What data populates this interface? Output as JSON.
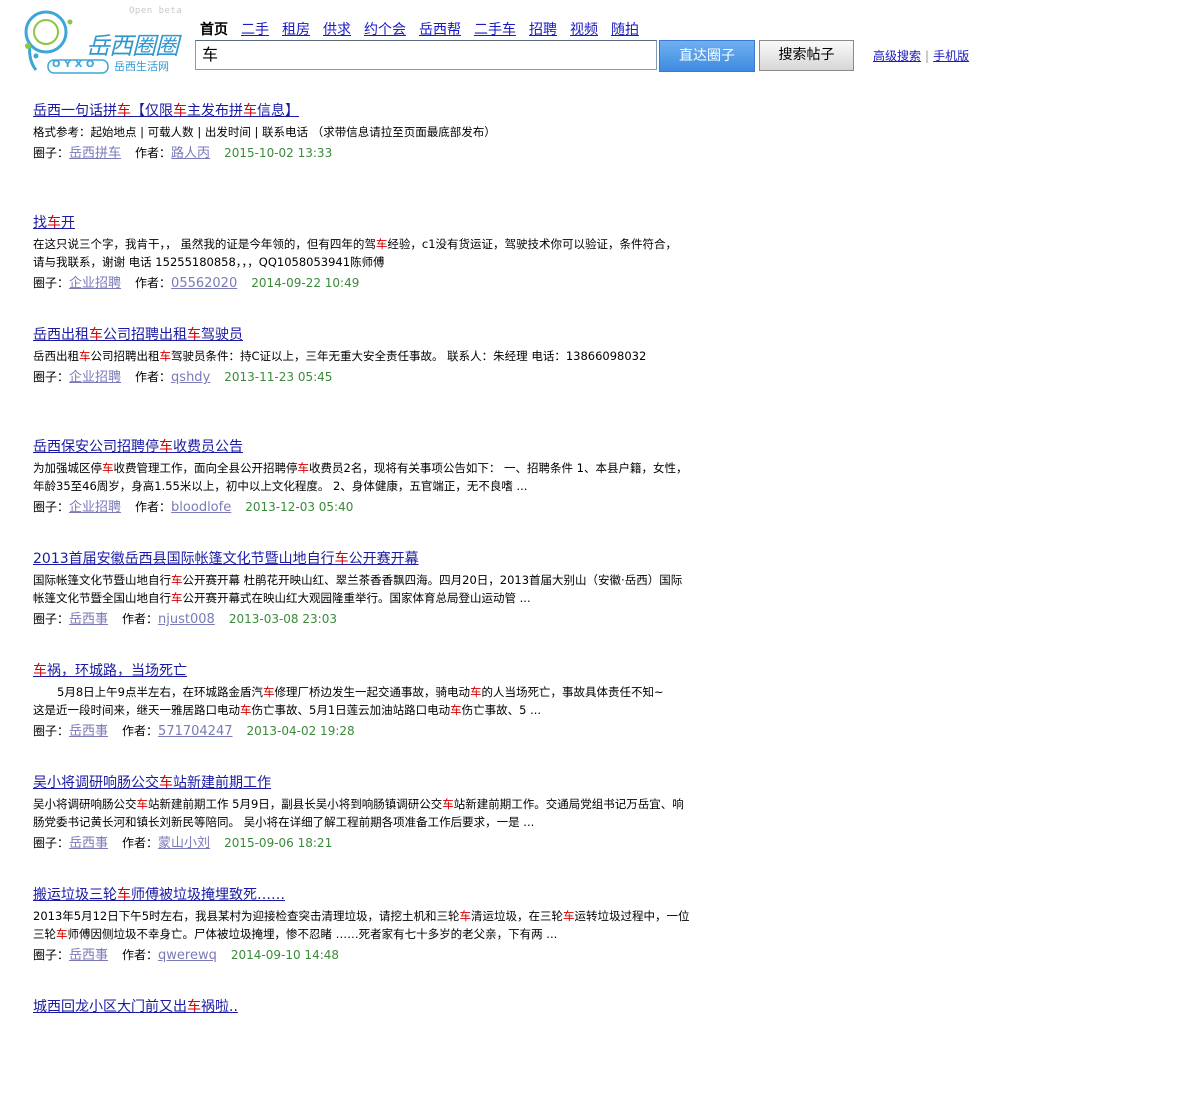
{
  "logo": {
    "brand": "岳西圈圈",
    "subtitle": "岳西生活网",
    "letters": "O Y X O",
    "badge": "Open beta"
  },
  "nav": [
    {
      "label": "首页",
      "current": true
    },
    {
      "label": "二手",
      "current": false
    },
    {
      "label": "租房",
      "current": false
    },
    {
      "label": "供求",
      "current": false
    },
    {
      "label": "约个会",
      "current": false
    },
    {
      "label": "岳西帮",
      "current": false
    },
    {
      "label": "二手车",
      "current": false
    },
    {
      "label": "招聘",
      "current": false
    },
    {
      "label": "视频",
      "current": false
    },
    {
      "label": "随拍",
      "current": false
    }
  ],
  "search": {
    "value": "车",
    "btn_circle": "直达圈子",
    "btn_posts": "搜索帖子",
    "advanced": "高级搜索",
    "mobile": "手机版",
    "sep": "|"
  },
  "labels": {
    "circle": "圈子：",
    "author": "作者："
  },
  "highlight_term": "车",
  "results": [
    {
      "title": "岳西一句话拼车【仅限车主发布拼车信息】",
      "snippet": [
        "格式参考：起始地点 | 可载人数 | 出发时间 | 联系电话 （求带信息请拉至页面最底部发布）"
      ],
      "circle": "岳西拼车",
      "author": "路人丙",
      "time": "2015-10-02 13:33"
    },
    {
      "title": "找车开",
      "snippet": [
        "在这只说三个字，我肯干，， 虽然我的证是今年领的，但有四年的驾车经验，c1没有货运证，驾驶技术你可以验证，条件符合，",
        "请与我联系，谢谢 电话 15255180858，，，QQ1058053941陈师傅"
      ],
      "circle": "企业招聘",
      "author": "05562020",
      "time": "2014-09-22 10:49"
    },
    {
      "title": "岳西出租车公司招聘出租车驾驶员",
      "snippet": [
        "岳西出租车公司招聘出租车驾驶员条件：持C证以上，三年无重大安全责任事故。 联系人：朱经理 电话：13866098032"
      ],
      "circle": "企业招聘",
      "author": "qshdy",
      "time": "2013-11-23 05:45"
    },
    {
      "title": "岳西保安公司招聘停车收费员公告",
      "snippet": [
        "为加强城区停车收费管理工作，面向全县公开招聘停车收费员2名，现将有关事项公告如下： 一、招聘条件 1、本县户籍，女性，",
        "年龄35至46周岁，身高1.55米以上，初中以上文化程度。 2、身体健康，五官端正，无不良嗜 ..."
      ],
      "circle": "企业招聘",
      "author": "bloodlofe",
      "time": "2013-12-03 05:40"
    },
    {
      "title": "2013首届安徽岳西县国际帐篷文化节暨山地自行车公开赛开幕",
      "snippet": [
        "国际帐篷文化节暨山地自行车公开赛开幕 杜鹃花开映山红、翠兰茶香香飘四海。四月20日，2013首届大别山（安徽·岳西）国际",
        "帐篷文化节暨全国山地自行车公开赛开幕式在映山红大观园隆重举行。国家体育总局登山运动管 ..."
      ],
      "circle": "岳西事",
      "author": "njust008",
      "time": "2013-03-08 23:03"
    },
    {
      "title": "车祸，环城路，当场死亡",
      "snippet": [
        "5月8日上午9点半左右，在环城路金盾汽车修理厂桥边发生一起交通事故，骑电动车的人当场死亡，事故具体责任不知~",
        "这是近一段时间来，继天一雅居路口电动车伤亡事故、5月1日莲云加油站路口电动车伤亡事故、5 ..."
      ],
      "indent_first": true,
      "circle": "岳西事",
      "author": "571704247",
      "time": "2013-04-02 19:28"
    },
    {
      "title": "吴小将调研响肠公交车站新建前期工作",
      "snippet": [
        "吴小将调研响肠公交车站新建前期工作 5月9日，副县长吴小将到响肠镇调研公交车站新建前期工作。交通局党组书记万岳宜、响",
        "肠党委书记黄长河和镇长刘新民等陪同。 吴小将在详细了解工程前期各项准备工作后要求，一是 ..."
      ],
      "circle": "岳西事",
      "author": "蒙山小刘",
      "time": "2015-09-06 18:21"
    },
    {
      "title": "搬运垃圾三轮车师傅被垃圾掩埋致死……",
      "snippet": [
        "2013年5月12日下午5时左右，我县某村为迎接检查突击清理垃圾，请挖土机和三轮车清运垃圾，在三轮车运转垃圾过程中，一位",
        "三轮车师傅因侧垃圾不幸身亡。尸体被垃圾掩埋，惨不忍睹 ……死者家有七十多岁的老父亲，下有两 ..."
      ],
      "circle": "岳西事",
      "author": "qwerewq",
      "time": "2014-09-10 14:48"
    },
    {
      "title": "城西回龙小区大门前又出车祸啦..",
      "snippet": [],
      "circle": "",
      "author": "",
      "time": ""
    }
  ]
}
